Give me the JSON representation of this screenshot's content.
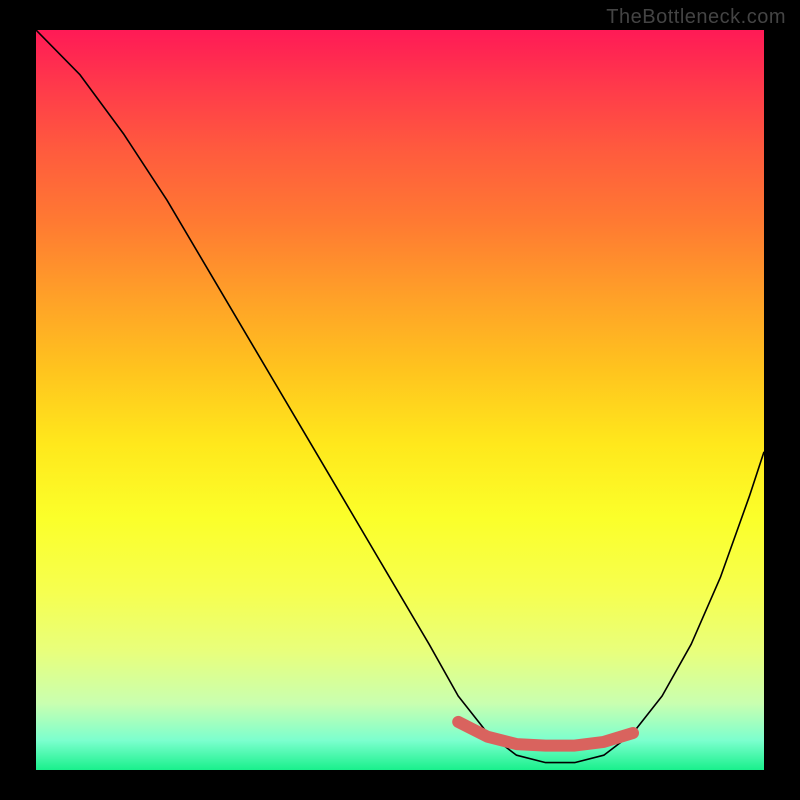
{
  "attribution": {
    "label": "TheBottleneck.com"
  },
  "chart_data": {
    "type": "line",
    "title": "",
    "xlabel": "",
    "ylabel": "",
    "xlim": [
      0,
      100
    ],
    "ylim": [
      0,
      100
    ],
    "series": [
      {
        "name": "bottleneck-curve",
        "x": [
          0,
          6,
          12,
          18,
          24,
          30,
          36,
          42,
          48,
          54,
          58,
          62,
          66,
          70,
          74,
          78,
          82,
          86,
          90,
          94,
          98,
          100
        ],
        "values": [
          100,
          94,
          86,
          77,
          67,
          57,
          47,
          37,
          27,
          17,
          10,
          5,
          2,
          1,
          1,
          2,
          5,
          10,
          17,
          26,
          37,
          43
        ]
      }
    ],
    "highlight": {
      "name": "optimal-range",
      "x": [
        58,
        62,
        66,
        70,
        74,
        78,
        82
      ],
      "values": [
        6.5,
        4.5,
        3.5,
        3.3,
        3.3,
        3.8,
        5.0
      ]
    }
  }
}
